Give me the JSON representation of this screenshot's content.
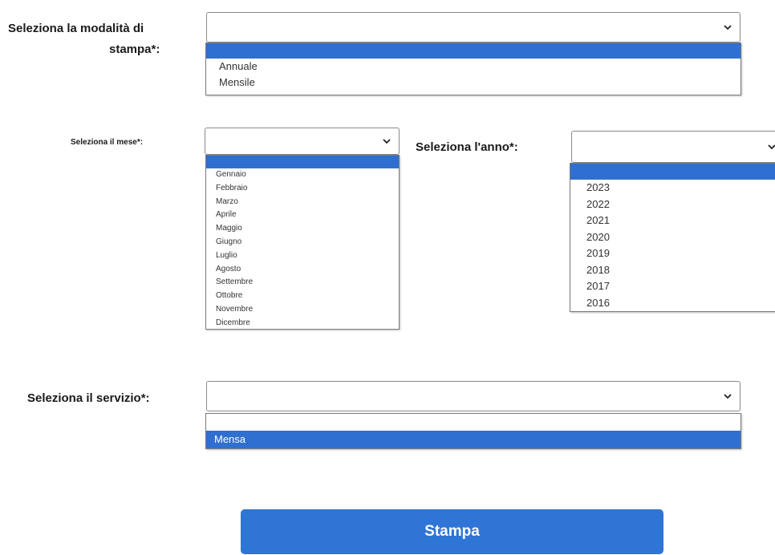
{
  "colors": {
    "highlight": "#2f6fd1",
    "button": "#2e75d6",
    "button_text": "#ffffff"
  },
  "modalita": {
    "label_line1": "Seleziona la modalità di",
    "label_line2": "stampa*:",
    "options": [
      "Annuale",
      "Mensile"
    ]
  },
  "mese": {
    "label": "Seleziona il mese*:",
    "options": [
      "Gennaio",
      "Febbraio",
      "Marzo",
      "Aprile",
      "Maggio",
      "Giugno",
      "Luglio",
      "Agosto",
      "Settembre",
      "Ottobre",
      "Novembre",
      "Dicembre"
    ]
  },
  "anno": {
    "label": "Seleziona l'anno*:",
    "options": [
      "2023",
      "2022",
      "2021",
      "2020",
      "2019",
      "2018",
      "2017",
      "2016"
    ]
  },
  "servizio": {
    "label": "Seleziona il servizio*:",
    "options": [
      "Mensa"
    ]
  },
  "submit": {
    "label": "Stampa"
  },
  "icons": {
    "dropdown": "chevron-down-icon"
  }
}
